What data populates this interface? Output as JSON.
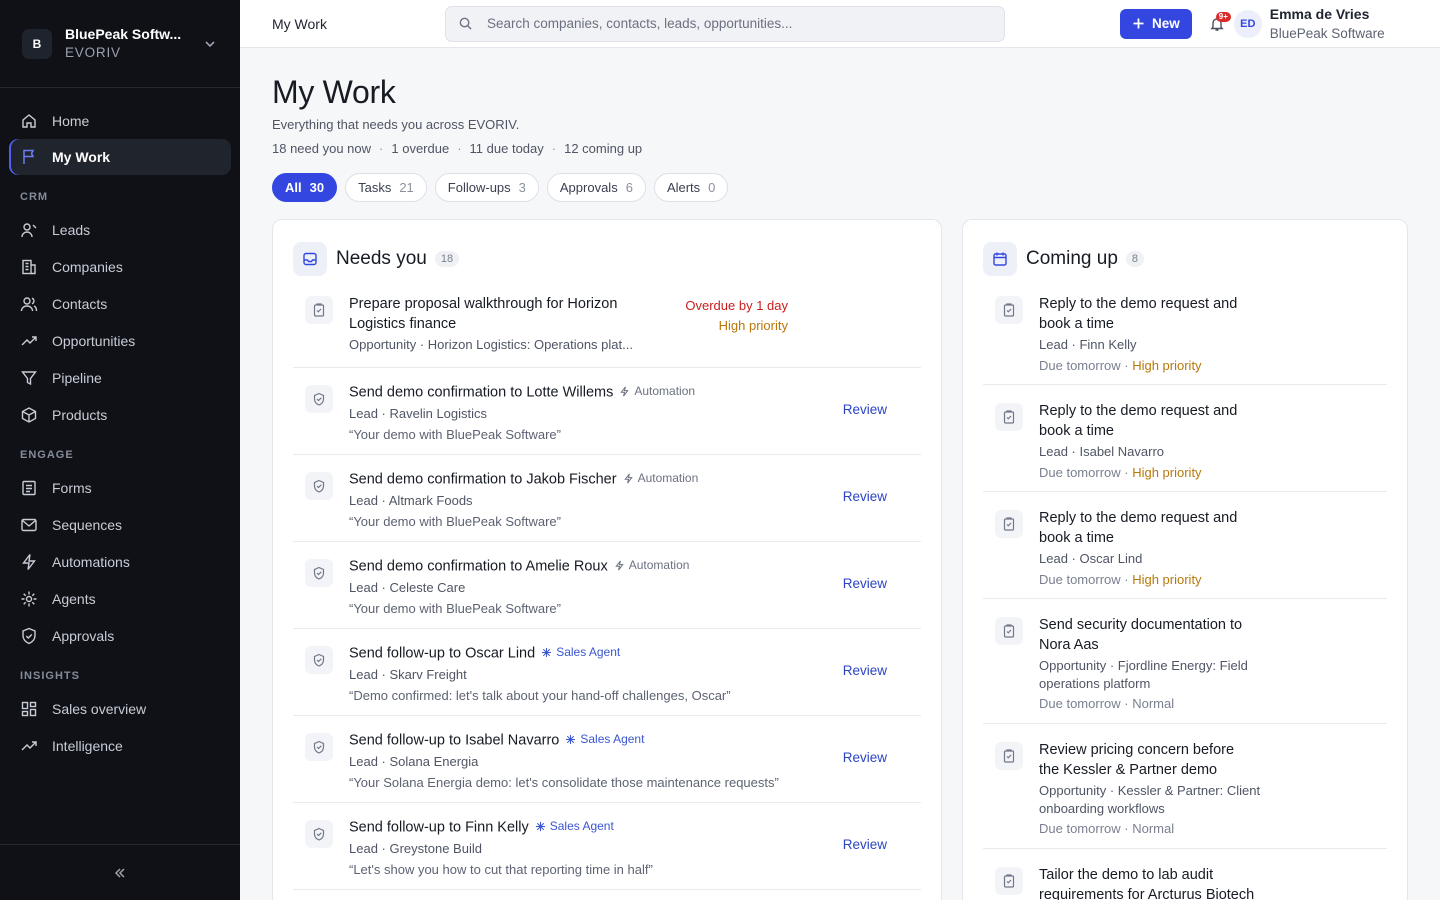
{
  "workspace": {
    "initial": "B",
    "name": "BluePeak Softw...",
    "sub": "EVORIV"
  },
  "nav": {
    "top": [
      {
        "label": "Home",
        "icon": "home-icon"
      },
      {
        "label": "My Work",
        "icon": "flag-icon"
      }
    ],
    "crm_label": "CRM",
    "crm": [
      {
        "label": "Leads"
      },
      {
        "label": "Companies"
      },
      {
        "label": "Contacts"
      },
      {
        "label": "Opportunities"
      },
      {
        "label": "Pipeline"
      },
      {
        "label": "Products"
      }
    ],
    "engage_label": "ENGAGE",
    "engage": [
      {
        "label": "Forms"
      },
      {
        "label": "Sequences"
      },
      {
        "label": "Automations"
      },
      {
        "label": "Agents"
      },
      {
        "label": "Approvals"
      }
    ],
    "insights_label": "INSIGHTS",
    "insights": [
      {
        "label": "Sales overview"
      },
      {
        "label": "Intelligence"
      }
    ]
  },
  "topbar": {
    "title": "My Work",
    "search_placeholder": "Search companies, contacts, leads, opportunities...",
    "new_label": "New",
    "notif_badge": "9+",
    "user_initials": "ED",
    "user_name": "Emma de Vries",
    "user_org": "BluePeak Software"
  },
  "page": {
    "title": "My Work",
    "subtitle": "Everything that needs you across EVORIV.",
    "stats": [
      "18 need you now",
      "1 overdue",
      "11 due today",
      "12 coming up"
    ]
  },
  "filters": [
    {
      "label": "All",
      "count": "30"
    },
    {
      "label": "Tasks",
      "count": "21"
    },
    {
      "label": "Follow-ups",
      "count": "3"
    },
    {
      "label": "Approvals",
      "count": "6"
    },
    {
      "label": "Alerts",
      "count": "0"
    }
  ],
  "needs_you": {
    "title": "Needs you",
    "count": "18",
    "first": {
      "title": "Prepare proposal walkthrough for Horizon Logistics finance",
      "meta": "Opportunity · Horizon Logistics: Operations plat...",
      "status1": "Overdue by 1 day",
      "status2": "High priority"
    },
    "items": [
      {
        "title": "Send demo confirmation to Lotte Willems",
        "tag": "Automation",
        "meta": "Lead · Ravelin Logistics",
        "quote": "“Your demo with BluePeak Software”",
        "action": "Review"
      },
      {
        "title": "Send demo confirmation to Jakob Fischer",
        "tag": "Automation",
        "meta": "Lead · Altmark Foods",
        "quote": "“Your demo with BluePeak Software”",
        "action": "Review"
      },
      {
        "title": "Send demo confirmation to Amelie Roux",
        "tag": "Automation",
        "meta": "Lead · Celeste Care",
        "quote": "“Your demo with BluePeak Software”",
        "action": "Review"
      },
      {
        "title": "Send follow-up to Oscar Lind",
        "tag": "Sales Agent",
        "meta": "Lead · Skarv Freight",
        "quote": "“Demo confirmed: let's talk about your hand-off challenges, Oscar”",
        "action": "Review"
      },
      {
        "title": "Send follow-up to Isabel Navarro",
        "tag": "Sales Agent",
        "meta": "Lead · Solana Energia",
        "quote": "“Your Solana Energia demo: let's consolidate those maintenance requests”",
        "action": "Review"
      },
      {
        "title": "Send follow-up to Finn Kelly",
        "tag": "Sales Agent",
        "meta": "Lead · Greystone Build",
        "quote": "“Let's show you how to cut that reporting time in half”",
        "action": "Review"
      }
    ]
  },
  "coming_up": {
    "title": "Coming up",
    "count": "8",
    "items": [
      {
        "title": "Reply to the demo request and book a time",
        "meta": "Lead · Finn Kelly",
        "due": "Due tomorrow",
        "priority": "High priority"
      },
      {
        "title": "Reply to the demo request and book a time",
        "meta": "Lead · Isabel Navarro",
        "due": "Due tomorrow",
        "priority": "High priority"
      },
      {
        "title": "Reply to the demo request and book a time",
        "meta": "Lead · Oscar Lind",
        "due": "Due tomorrow",
        "priority": "High priority"
      },
      {
        "title": "Send security documentation to Nora Aas",
        "meta": "Opportunity · Fjordline Energy: Field operations platform",
        "due": "Due tomorrow",
        "priority": "Normal"
      },
      {
        "title": "Review pricing concern before the Kessler & Partner demo",
        "meta": "Opportunity · Kessler & Partner: Client onboarding workflows",
        "due": "Due tomorrow",
        "priority": "Normal"
      },
      {
        "title": "Tailor the demo to lab audit requirements for Arcturus Biotech",
        "meta": "",
        "due": "",
        "priority": ""
      }
    ]
  },
  "colors": {
    "accent": "#3347e0",
    "sidebar": "#0f1117",
    "overdue": "#c81e1e",
    "high_priority": "#b7790a"
  }
}
